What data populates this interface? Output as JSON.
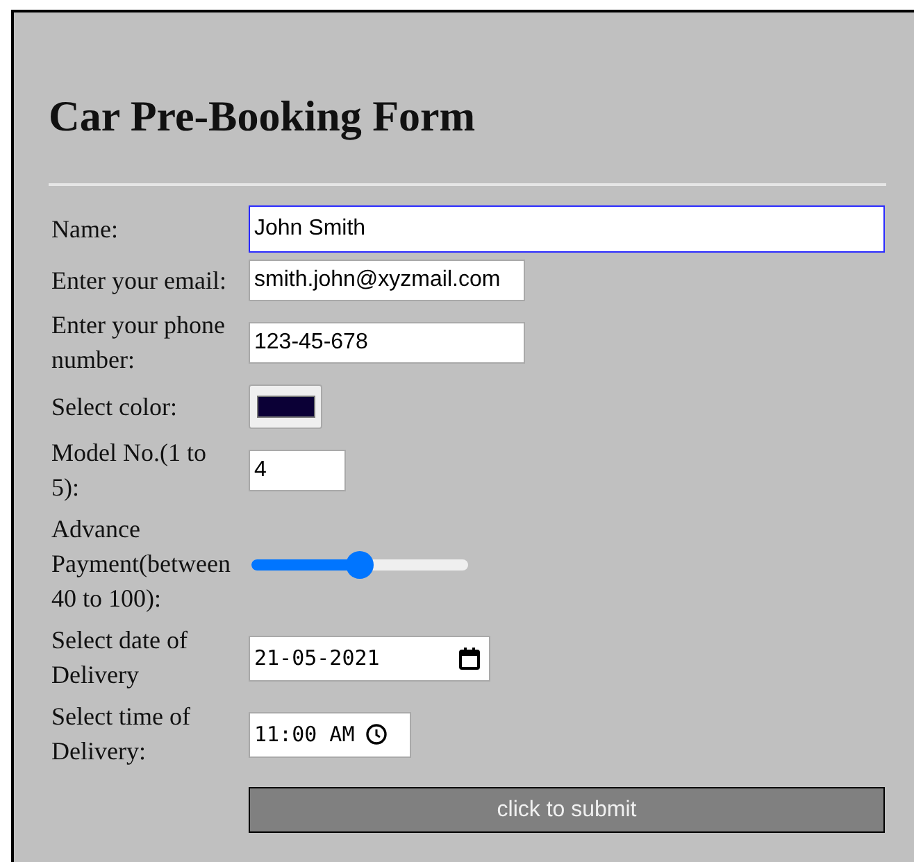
{
  "title": "Car Pre-Booking Form",
  "fields": [
    {
      "kind": "text",
      "label": "Name:",
      "value": "John Smith",
      "focused": true
    },
    {
      "kind": "text",
      "label": "Enter your email:",
      "value": "smith.john@xyzmail.com",
      "focused": false
    },
    {
      "kind": "text",
      "label": "Enter your phone number:",
      "value": "123-45-678",
      "focused": false
    },
    {
      "kind": "color",
      "label": "Select color:",
      "color": "#0b0036",
      "focused": false
    },
    {
      "kind": "number",
      "label": "Model No.(1 to 5):",
      "value": "4",
      "focused": false
    },
    {
      "kind": "range",
      "label": "Advance Payment(between 40 to 100):",
      "level": 0.5,
      "focused": false
    },
    {
      "kind": "date",
      "label": "Select date of Delivery",
      "value": "21-05-2021",
      "focused": false
    },
    {
      "kind": "time",
      "label": "Select time of Delivery:",
      "value": "11:00 AM",
      "focused": false
    }
  ],
  "submit": "click to submit"
}
